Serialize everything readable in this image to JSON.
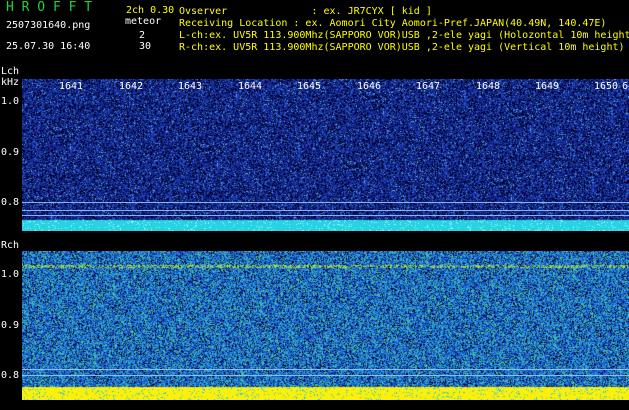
{
  "header": {
    "logo": "H R O F F T",
    "version": "2ch 0.30",
    "mode": "meteor",
    "filename": "2507301640.png",
    "datetime": "25.07.30 16:40",
    "lch_count": "2",
    "rch_count": "30",
    "observer_line": "Ovserver              : ex. JR7CYX [ kid ]",
    "location_line": "Receiving Location : ex. Aomori City Aomori-Pref.JAPAN(40.49N, 140.47E)",
    "lch_line": "L-ch:ex. UV5R 113.900Mhz(SAPPORO VOR)USB ,2-ele yagi (Holozontal 10m height",
    "rch_line": "R-ch:ex. UV5R 113.900Mhz(SAPPORO VOR)USB ,2-ele yagi (Vertical 10m height)"
  },
  "lch": {
    "label": "Lch",
    "unit": "kHz",
    "hours": [
      "1641",
      "1642",
      "1643",
      "1644",
      "1645",
      "1646",
      "1647",
      "1648",
      "1649",
      "1650",
      "6"
    ],
    "ticks": [
      "1.0",
      "0.9",
      "0.8"
    ]
  },
  "rch": {
    "label": "Rch",
    "ticks": [
      "1.0",
      "0.9",
      "0.8"
    ]
  },
  "colors": {
    "logo": "#1fd13a",
    "header_text": "#ffff00",
    "background": "#000000",
    "lch_noise": "#1a2a8a",
    "lch_baseline": "#2ad6e0",
    "rch_noise": "#1e58b8",
    "rch_baseline": "#ffff00"
  }
}
